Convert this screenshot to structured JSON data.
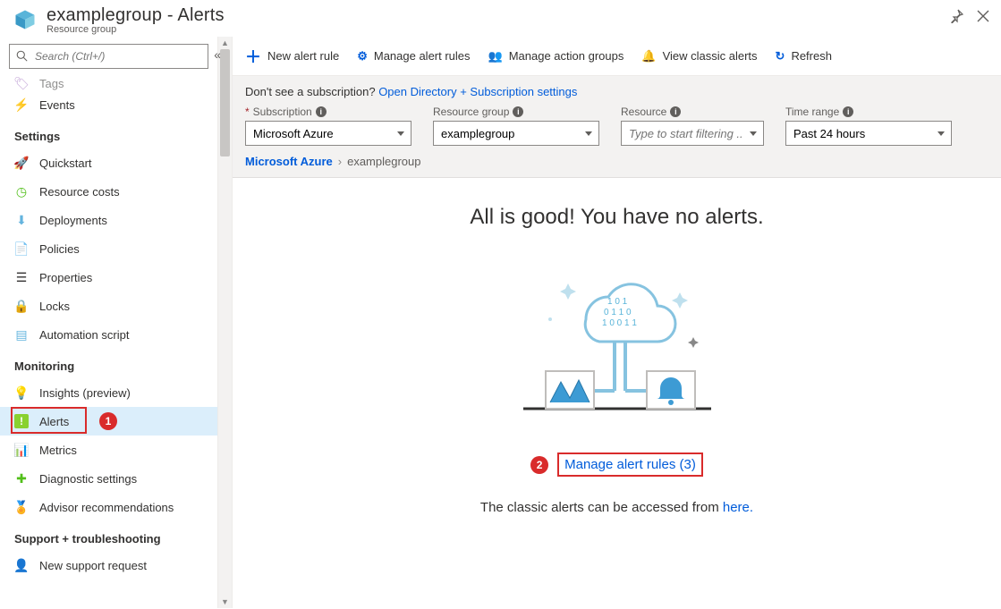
{
  "header": {
    "title": "examplegroup - Alerts",
    "subtitle": "Resource group",
    "pin_tooltip": "Pin",
    "close_tooltip": "Close"
  },
  "sidebar": {
    "search_placeholder": "Search (Ctrl+/)",
    "top_items": [
      {
        "label": "Tags",
        "icon": "tag",
        "color": "#945db7"
      },
      {
        "label": "Events",
        "icon": "bolt",
        "color": "#f2b200"
      }
    ],
    "sections": [
      {
        "title": "Settings",
        "items": [
          {
            "label": "Quickstart",
            "icon": "rocket",
            "color": "#64b4de"
          },
          {
            "label": "Resource costs",
            "icon": "cost",
            "color": "#52bf1a"
          },
          {
            "label": "Deployments",
            "icon": "deploy",
            "color": "#64b4de"
          },
          {
            "label": "Policies",
            "icon": "policy",
            "color": "#64b4de"
          },
          {
            "label": "Properties",
            "icon": "props",
            "color": "#323130"
          },
          {
            "label": "Locks",
            "icon": "lock",
            "color": "#323130"
          },
          {
            "label": "Automation script",
            "icon": "script",
            "color": "#64b4de"
          }
        ]
      },
      {
        "title": "Monitoring",
        "items": [
          {
            "label": "Insights (preview)",
            "icon": "bulb",
            "color": "#015cda"
          },
          {
            "label": "Alerts",
            "icon": "alert",
            "color": "#89d130",
            "active": true,
            "callout": "1"
          },
          {
            "label": "Metrics",
            "icon": "metrics",
            "color": "#015cda"
          },
          {
            "label": "Diagnostic settings",
            "icon": "diag",
            "color": "#52bf1a"
          },
          {
            "label": "Advisor recommendations",
            "icon": "advisor",
            "color": "#f2b200"
          }
        ]
      },
      {
        "title": "Support + troubleshooting",
        "items": [
          {
            "label": "New support request",
            "icon": "support",
            "color": "#64b4de"
          }
        ]
      }
    ]
  },
  "toolbar": {
    "new_alert": "New alert rule",
    "manage_rules": "Manage alert rules",
    "manage_groups": "Manage action groups",
    "view_classic": "View classic alerts",
    "refresh": "Refresh"
  },
  "filterbar": {
    "hint_prefix": "Don't see a subscription? ",
    "hint_link": "Open Directory + Subscription settings",
    "subscription": {
      "label": "Subscription",
      "value": "Microsoft Azure",
      "required": true
    },
    "resource_group": {
      "label": "Resource group",
      "value": "examplegroup"
    },
    "resource": {
      "label": "Resource",
      "placeholder": "Type to start filtering ..."
    },
    "time_range": {
      "label": "Time range",
      "value": "Past 24 hours"
    },
    "breadcrumb": {
      "root": "Microsoft Azure",
      "current": "examplegroup"
    }
  },
  "content": {
    "headline": "All is good! You have no alerts.",
    "manage_link": "Manage alert rules (3)",
    "manage_callout": "2",
    "classic_text": "The classic alerts can be accessed from ",
    "classic_link": "here."
  }
}
